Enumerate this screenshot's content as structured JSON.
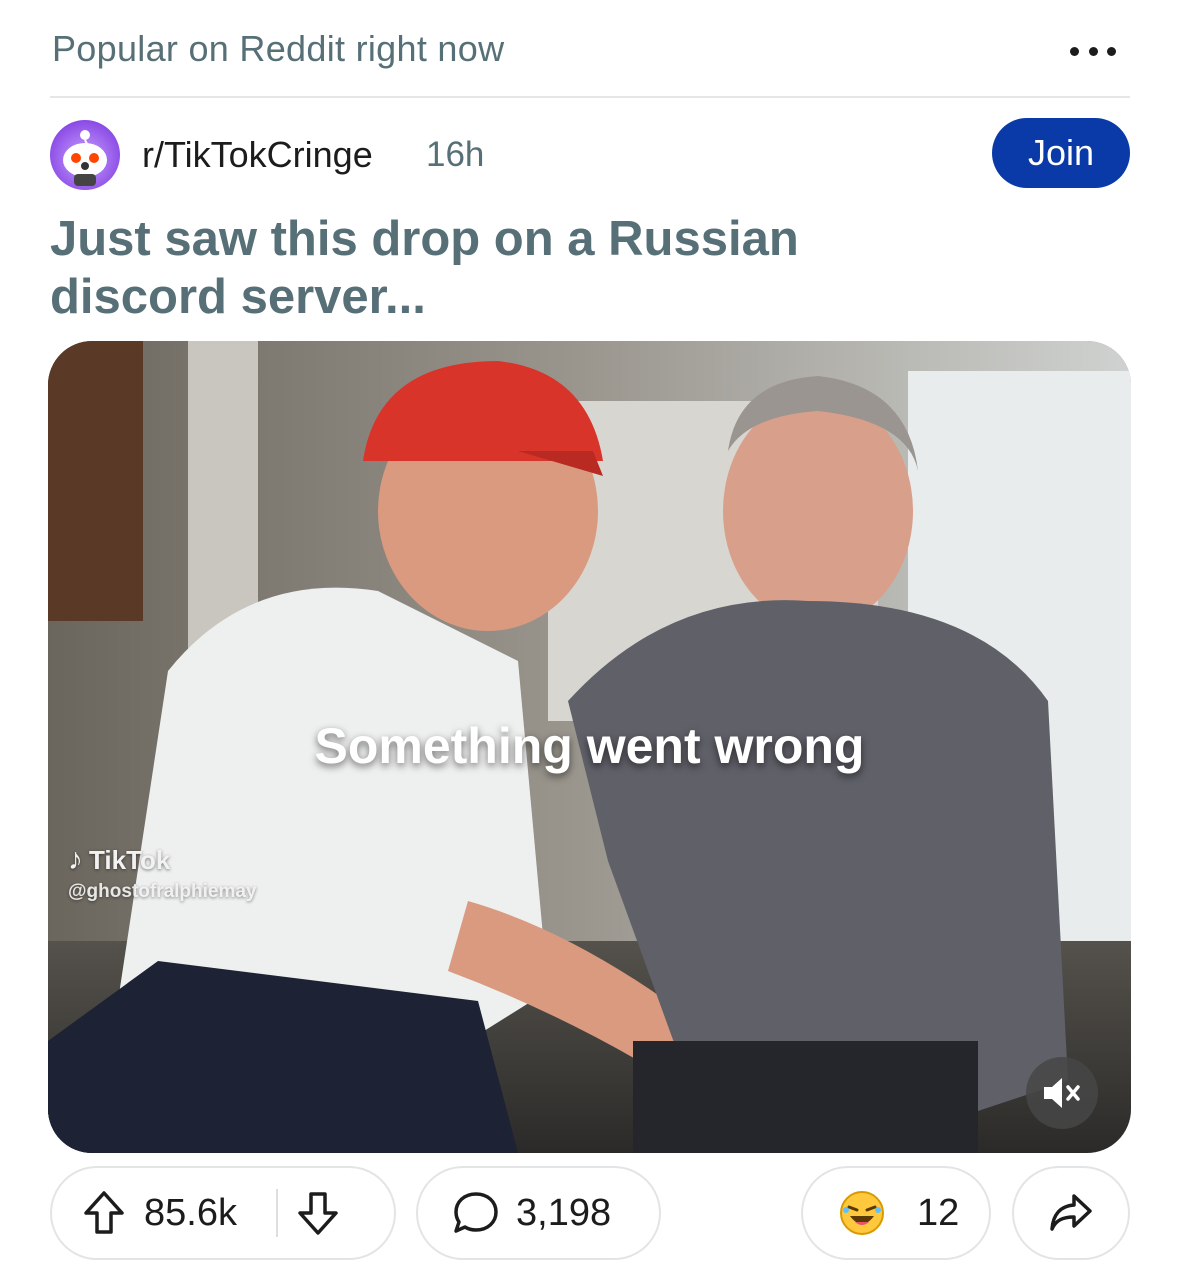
{
  "section": {
    "title": "Popular on Reddit right now",
    "more_icon": "more-horizontal-icon"
  },
  "post": {
    "community": "r/TikTokCringe",
    "age": "16h",
    "join_label": "Join",
    "title": "Just saw this drop on a Russian discord server...",
    "media": {
      "error_message": "Something went wrong",
      "watermark_brand": "TikTok",
      "watermark_handle": "@ghostofralphiemay",
      "mute_icon": "volume-muted-icon"
    },
    "actions": {
      "upvote_icon": "upvote-arrow-icon",
      "score": "85.6k",
      "downvote_icon": "downvote-arrow-icon",
      "comment_icon": "comment-bubble-icon",
      "comments": "3,198",
      "award_icon": "laughing-award-icon",
      "awards": "12",
      "share_icon": "share-arrow-icon"
    }
  },
  "colors": {
    "join_button": "#0a3aa8",
    "muted_text": "#576f76",
    "divider": "#e4e6e8"
  }
}
